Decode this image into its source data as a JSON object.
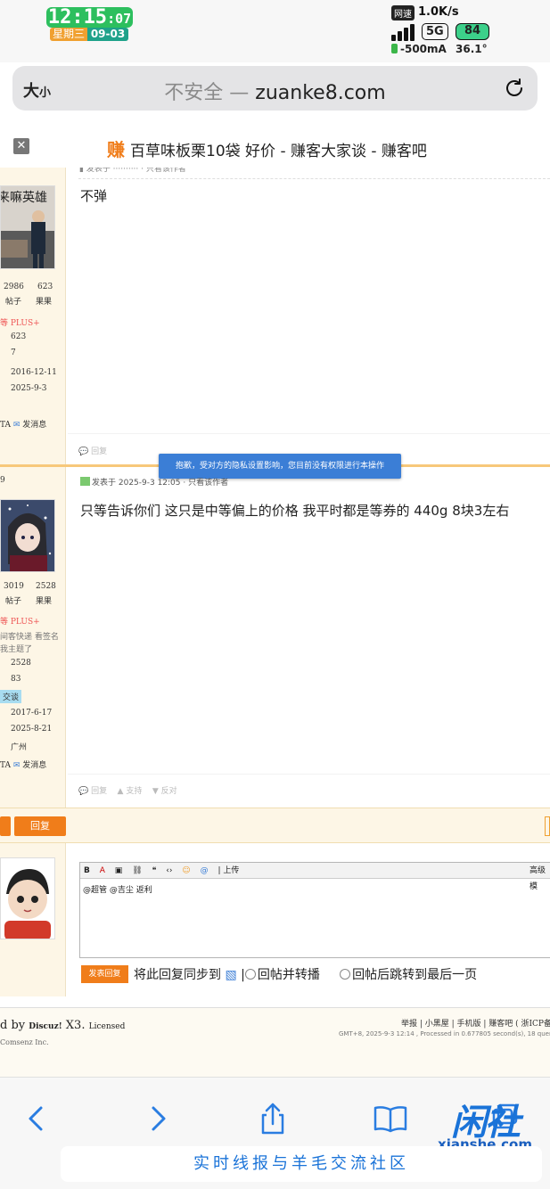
{
  "status": {
    "time_hm": "12:15",
    "time_s": ":07",
    "weekday": "星期三",
    "date": "09-03",
    "net_label": "网速",
    "net_speed": "1.0K/s",
    "network": "5G",
    "battery": "84",
    "current": "-500mA",
    "temperature": "36.1°"
  },
  "browser": {
    "text_size": "大",
    "text_size_small": "小",
    "insecure": "不安全 —",
    "domain": "zuanke8.com"
  },
  "page_title": {
    "logo": "赚",
    "title": "百草味板栗10袋 好价 - 赚客大家谈 - 赚客吧"
  },
  "posts": [
    {
      "username": "来嘛英雄",
      "posts_count": "2986",
      "posts_label": "帖子",
      "fruits_count": "623",
      "fruits_label": "果果",
      "level": "PLUS+",
      "stat1": "623",
      "stat2": "7",
      "reg_date": "2016-12-11",
      "last_date": "2025-9-3",
      "sendmsg": "发消息",
      "content": "不弹",
      "reply": "回复"
    },
    {
      "floor": "9",
      "posts_count": "3019",
      "posts_label": "帖子",
      "fruits_count": "2528",
      "fruits_label": "果果",
      "level": "PLUS+",
      "sig1": "间客快递 看签名",
      "sig2": "我主题了",
      "stat1": "2528",
      "stat2": "83",
      "tag": "交谈",
      "reg_date": "2017-6-17",
      "last_date": "2025-8-21",
      "location": "广州",
      "sendmsg": "发消息",
      "meta": "发表于 2025-9-3 12:05",
      "content": "只等告诉你们 这只是中等偏上的价格 我平时都是等券的 440g 8块3左右",
      "reply": "回复",
      "support": "支持",
      "oppose": "反对"
    }
  ],
  "toast": "抱歉，受对方的隐私设置影响，您目前没有权限进行本操作",
  "reply_button": "回复",
  "editor": {
    "upload": "上传",
    "advanced": "高级模",
    "text": "@超管 @吉尘 返利",
    "submit": "发表回复",
    "sync": "将此回复同步到",
    "opt1": "回帖并转播",
    "opt2": "回帖后跳转到最后一页"
  },
  "footer": {
    "powered": "d by",
    "discuz": "Discuz!",
    "version": "X3.",
    "licensed": "Licensed",
    "comsenz": "Comsenz Inc.",
    "links": "举报 | 小黑屋 | 手机版 | 赚客吧 ( 浙ICP备",
    "gmt": "GMT+8, 2025-9-3 12:14 , Processed in 0.677805 second(s), 18 queries"
  },
  "watermark": {
    "cn": "闲社",
    "domain": "xianshe.com",
    "slogan": "实时线报与羊毛交流社区"
  }
}
